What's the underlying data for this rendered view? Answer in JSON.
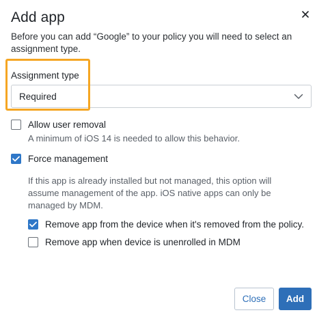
{
  "dialog": {
    "title": "Add app",
    "description": "Before you can add “Google” to your policy you will need to select an assignment type."
  },
  "assignment": {
    "label": "Assignment type",
    "selected": "Required"
  },
  "options": {
    "allow_user_removal": {
      "label": "Allow user removal",
      "checked": false,
      "helper": "A minimum of iOS 14 is needed to allow this behavior."
    },
    "force_management": {
      "label": "Force management",
      "checked": true,
      "helper": "If this app is already installed but not managed, this option will assume management of the app. iOS native apps can only be managed by MDM."
    },
    "remove_on_policy_removal": {
      "label": "Remove app from the device when it's removed from the policy.",
      "checked": true
    },
    "remove_on_unenroll": {
      "label": "Remove app when device is unenrolled in MDM",
      "checked": false
    }
  },
  "footer": {
    "close_label": "Close",
    "add_label": "Add"
  },
  "colors": {
    "accent": "#2e6fb8",
    "checkbox_checked": "#2e77c8",
    "highlight": "#f5a623"
  },
  "icons": {
    "close": "close-icon",
    "dropdown": "chevron-down-icon",
    "check": "check-icon"
  }
}
